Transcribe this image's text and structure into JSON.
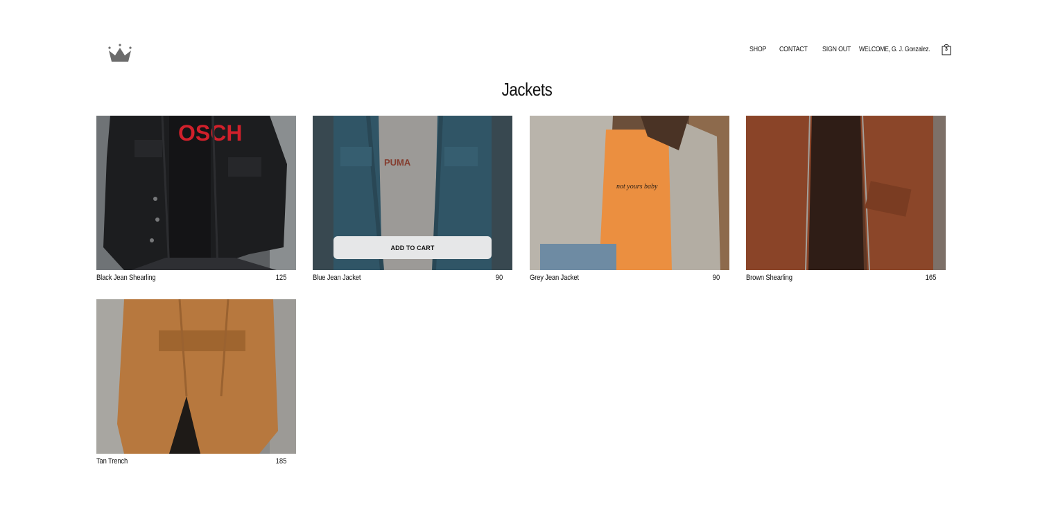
{
  "brand": {
    "logo_icon": "crown-icon"
  },
  "nav": {
    "shop": "SHOP",
    "contact": "CONTACT",
    "sign_out": "SIGN OUT",
    "welcome": "WELCOME, G. J. Gonzalez.",
    "cart_icon": "shopping-bag-icon",
    "cart_count": "3"
  },
  "page": {
    "title": "Jackets"
  },
  "products": [
    {
      "name": "Black Jean Shearling",
      "price": "125"
    },
    {
      "name": "Blue Jean Jacket",
      "price": "90",
      "hovered": true,
      "add_to_cart": "ADD TO CART"
    },
    {
      "name": "Grey Jean Jacket",
      "price": "90"
    },
    {
      "name": "Brown Shearling",
      "price": "165"
    },
    {
      "name": "Tan Trench",
      "price": "185"
    }
  ]
}
